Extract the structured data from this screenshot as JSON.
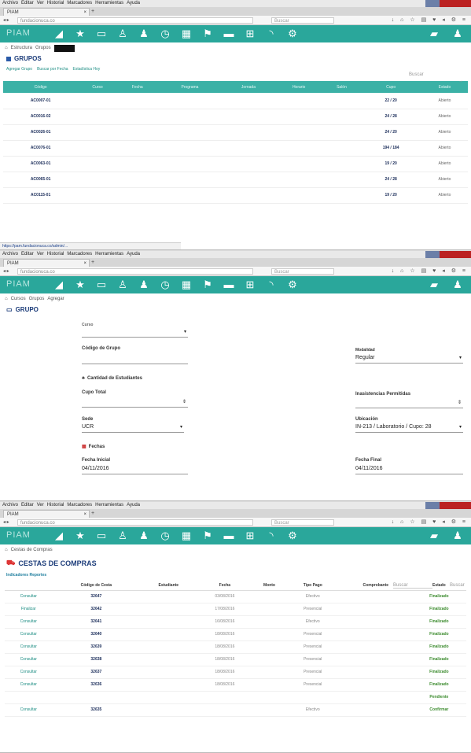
{
  "browser": {
    "menu": [
      "Archivo",
      "Editar",
      "Ver",
      "Historial",
      "Marcadores",
      "Herramientas",
      "Ayuda"
    ],
    "tab_title": "PIAM",
    "new_tab": "+",
    "search_placeholder": "Buscar",
    "url_host": "fundacionuca.co"
  },
  "app": {
    "brand": "PIAM",
    "nav_icons": [
      "chart-icon",
      "star-icon",
      "desktop-icon",
      "user-icon",
      "chalkboard-icon",
      "clock-icon",
      "calendar-icon",
      "flag-icon",
      "building-icon",
      "grid-icon",
      "rss-icon",
      "gears-icon"
    ],
    "right_icons": [
      "message-icon",
      "user-icon"
    ]
  },
  "screen1": {
    "breadcrumb": [
      "Estructura",
      "Grupos"
    ],
    "title": "GRUPOS",
    "toplinks": [
      "Agregar Grupo",
      "Buscar por Fecha",
      "Estadística Hoy"
    ],
    "columns": [
      "Código",
      "Curso",
      "Fecha",
      "Programa",
      "Jornada",
      "Horario",
      "Salón",
      "Cupo",
      "Estado"
    ],
    "rows": [
      {
        "code": "AC0007-01",
        "cupo": "22 / 20",
        "estado": "Abierto"
      },
      {
        "code": "AC0016-02",
        "cupo": "24 / 28",
        "estado": "Abierto"
      },
      {
        "code": "AC0026-01",
        "cupo": "24 / 20",
        "estado": "Abierto"
      },
      {
        "code": "AC0076-01",
        "cupo": "194 / 184",
        "estado": "Abierto"
      },
      {
        "code": "AC0063-01",
        "cupo": "19 / 20",
        "estado": "Abierto"
      },
      {
        "code": "AC0065-01",
        "cupo": "24 / 28",
        "estado": "Abierto"
      },
      {
        "code": "AC0115-01",
        "cupo": "19 / 20",
        "estado": "Abierto"
      }
    ],
    "status_url": "https://pam.fundacionuca.co/admin/..."
  },
  "screen2": {
    "breadcrumb": [
      "Cursos",
      "Grupos",
      "Agregar"
    ],
    "title": "GRUPO",
    "curso_label": "Curso",
    "codigo_label": "Código de Grupo",
    "modalidad_label": "Modalidad",
    "modalidad_value": "Regular",
    "cantidad_section": "Cantidad de Estudiantes",
    "cupo_total_label": "Cupo Total",
    "inasist_label": "Inasistencias Permitidas",
    "sede_label": "Sede",
    "sede_value": "UCR",
    "ubicacion_label": "Ubicación",
    "ubicacion_value": "IN-213 / Laboratorio / Cupo: 28",
    "fechas_section": "Fechas",
    "fecha_inicial_label": "Fecha Inicial",
    "fecha_inicial_value": "04/11/2016",
    "fecha_final_label": "Fecha Final",
    "fecha_final_value": "04/11/2016"
  },
  "screen3": {
    "breadcrumb": [
      "Cestas de Compras"
    ],
    "title": "CESTAS DE COMPRAS",
    "search_label": "Buscar",
    "subtitle": "Indicadores Reportes",
    "columns": [
      "",
      "Código de Cesta",
      "Estudiante",
      "Fecha",
      "Monto",
      "Tipo Pago",
      "Comprobante",
      "Estado"
    ],
    "rows": [
      {
        "action": "Consultar",
        "code": "32647",
        "date": "03/08/2016",
        "amount": "",
        "pay": "Efectivo",
        "status": "Finalizado"
      },
      {
        "action": "Finalizar",
        "code": "32642",
        "date": "17/08/2016",
        "amount": "",
        "pay": "Presencial",
        "status": "Finalizado"
      },
      {
        "action": "Consultar",
        "code": "32641",
        "date": "16/08/2016",
        "amount": "",
        "pay": "Efectivo",
        "status": "Finalizado"
      },
      {
        "action": "Consultar",
        "code": "32640",
        "date": "18/08/2016",
        "amount": "",
        "pay": "Presencial",
        "status": "Finalizado"
      },
      {
        "action": "Consultar",
        "code": "32639",
        "date": "18/08/2016",
        "amount": "",
        "pay": "Presencial",
        "status": "Finalizado"
      },
      {
        "action": "Consultar",
        "code": "32638",
        "date": "18/08/2016",
        "amount": "",
        "pay": "Presencial",
        "status": "Finalizado"
      },
      {
        "action": "Consultar",
        "code": "32637",
        "date": "18/08/2016",
        "amount": "",
        "pay": "Presencial",
        "status": "Finalizado"
      },
      {
        "action": "Consultar",
        "code": "32636",
        "date": "18/08/2016",
        "amount": "",
        "pay": "Presencial",
        "status": "Finalizado"
      },
      {
        "action": "",
        "code": "",
        "date": "",
        "amount": "",
        "pay": "",
        "status": "Pendiente"
      },
      {
        "action": "Consultar",
        "code": "32635",
        "date": "",
        "amount": "",
        "pay": "Efectivo",
        "status": "Confirmar"
      }
    ]
  },
  "colors": {
    "accent": "#2aa79b",
    "header_grid": "#3bb1a6",
    "title": "#1d3d7a"
  }
}
